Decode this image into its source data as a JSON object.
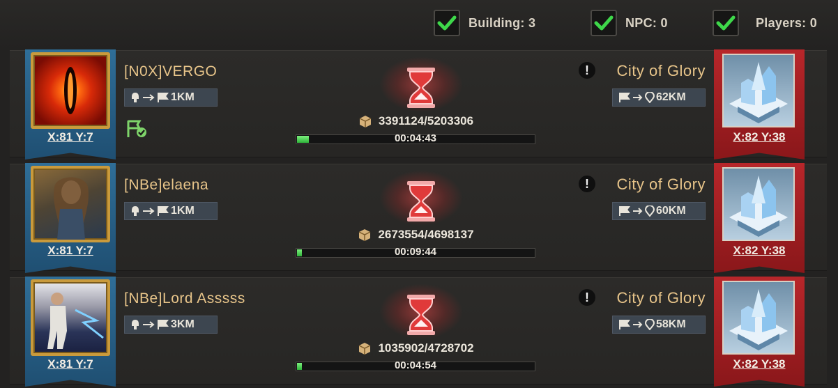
{
  "filters": [
    {
      "label": "Building: 3",
      "checked": true
    },
    {
      "label": "NPC: 0",
      "checked": true
    },
    {
      "label": "Players: 0",
      "checked": true
    }
  ],
  "rows": [
    {
      "player": "[N0X]VERGO",
      "origin_coord": "X:81 Y:7",
      "march_dist": "1KM",
      "target": "City of Glory",
      "target_dist": "62KM",
      "target_coord": "X:82 Y:38",
      "resources": "3391124/5203306",
      "timer": "00:04:43",
      "progress": 0.05,
      "rally_flag_checked": true
    },
    {
      "player": "[NBe]elaena",
      "origin_coord": "X:81 Y:7",
      "march_dist": "1KM",
      "target": "City of Glory",
      "target_dist": "60KM",
      "target_coord": "X:82 Y:38",
      "resources": "2673554/4698137",
      "timer": "00:09:44",
      "progress": 0.02,
      "rally_flag_checked": false
    },
    {
      "player": "[NBe]Lord Asssss",
      "origin_coord": "X:81 Y:7",
      "march_dist": "3KM",
      "target": "City of Glory",
      "target_dist": "58KM",
      "target_coord": "X:82 Y:38",
      "resources": "1035902/4728702",
      "timer": "00:04:54",
      "progress": 0.02,
      "rally_flag_checked": false
    }
  ],
  "colors": {
    "progress_green": "#3fcf4a",
    "hourglass_red": "#e03a3a",
    "name_gold": "#e8c58a"
  }
}
